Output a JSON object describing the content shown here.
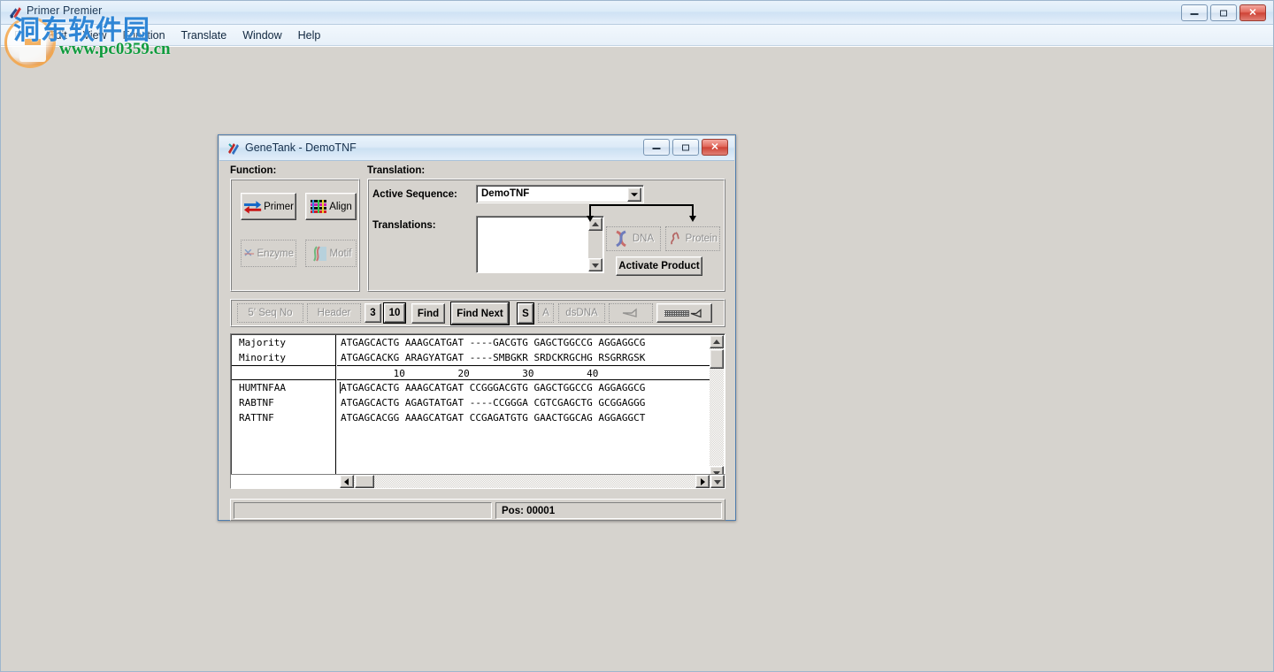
{
  "app": {
    "title": "Primer Premier",
    "icon": "app-icon",
    "menu": [
      "File",
      "Edit",
      "View",
      "Function",
      "Translate",
      "Window",
      "Help"
    ],
    "window_controls": [
      {
        "name": "minimize-button",
        "glyph": "minimize-icon"
      },
      {
        "name": "restore-button",
        "glyph": "restore-icon"
      },
      {
        "name": "close-button",
        "glyph": "close-icon"
      }
    ]
  },
  "watermark": {
    "chinese": "洞东软件园",
    "url": "www.pc0359.cn"
  },
  "child_window": {
    "title": "GeneTank - DemoTNF",
    "icon": "genetank-icon",
    "window_controls": [
      {
        "name": "minimize-button",
        "glyph": "minimize-icon"
      },
      {
        "name": "restore-button",
        "glyph": "restore-icon"
      },
      {
        "name": "close-button",
        "glyph": "close-icon"
      }
    ]
  },
  "function_panel": {
    "label": "Function:",
    "buttons": [
      {
        "label": "Primer",
        "icon": "primer-arrows-icon",
        "enabled": true
      },
      {
        "label": "Align",
        "icon": "align-bars-icon",
        "enabled": true
      },
      {
        "label": "Enzyme",
        "icon": "enzyme-icon",
        "enabled": false
      },
      {
        "label": "Motif",
        "icon": "motif-icon",
        "enabled": false
      }
    ]
  },
  "translation_panel": {
    "label": "Translation:",
    "active_sequence_label": "Active Sequence:",
    "active_sequence_value": "DemoTNF",
    "active_sequence_options": [
      "DemoTNF"
    ],
    "translations_label": "Translations:",
    "translations_items": [],
    "dna_button": {
      "label": "DNA",
      "icon": "dna-helix-icon",
      "enabled": false
    },
    "protein_button": {
      "label": "Protein",
      "icon": "protein-icon",
      "enabled": false
    },
    "activate_product_button": "Activate Product"
  },
  "toolbar": {
    "buttons": [
      {
        "label": "5' Seq No",
        "name": "seq-no-button",
        "enabled": false,
        "pressed": false
      },
      {
        "label": "Header",
        "name": "header-button",
        "enabled": false,
        "pressed": false
      },
      {
        "label": "3",
        "name": "frame-3-button",
        "enabled": true,
        "pressed": false
      },
      {
        "label": "10",
        "name": "frame-10-button",
        "enabled": true,
        "pressed": true
      },
      {
        "label": "Find",
        "name": "find-button",
        "enabled": true,
        "pressed": false
      },
      {
        "label": "Find Next",
        "name": "find-next-button",
        "enabled": true,
        "pressed": false
      },
      {
        "label": "S",
        "name": "sense-button",
        "enabled": true,
        "pressed": true
      },
      {
        "label": "A",
        "name": "antisense-button",
        "enabled": false,
        "pressed": false
      },
      {
        "label": "dsDNA",
        "name": "dsdna-button",
        "enabled": false,
        "pressed": false
      },
      {
        "label": "",
        "name": "linear-dna-button",
        "enabled": false,
        "pressed": false,
        "icon": "linear-dna-icon"
      },
      {
        "label": "",
        "name": "aligned-dna-button",
        "enabled": true,
        "pressed": true,
        "icon": "aligned-dna-icon"
      }
    ]
  },
  "sequence_view": {
    "consensus_rows": [
      {
        "name": "Majority",
        "sequence": "ATGAGCACTG AAAGCATGAT ----GACGTG GAGCTGGCCG AGGAGGCG"
      },
      {
        "name": "Minority",
        "sequence": "ATGAGCACKG ARAGYATGAT ----SMBGKR SRDCKRGCHG RSGRRGSK"
      }
    ],
    "ruler": "         10         20         30         40",
    "ruler_ticks": [
      "10",
      "20",
      "30",
      "40"
    ],
    "sequence_rows": [
      {
        "name": "HUMTNFAA",
        "sequence": "ATGAGCACTG AAAGCATGAT CCGGGACGTG GAGCTGGCCG AGGAGGCG"
      },
      {
        "name": "RABTNF",
        "sequence": "ATGAGCACTG AGAGTATGAT ----CCGGGA CGTCGAGCTG GCGGAGGG"
      },
      {
        "name": "RATTNF",
        "sequence": "ATGAGCACGG AAAGCATGAT CCGAGATGTG GAACTGGCAG AGGAGGCT"
      }
    ]
  },
  "statusbar": {
    "left_text": "",
    "position_label": "Pos:  00001"
  },
  "colors": {
    "face": "#d6d3ce",
    "titlebar_blue": "#cfe2f4",
    "close_red": "#cf4336",
    "watermark_blue": "#2f86d6",
    "watermark_green": "#0f9b3d"
  }
}
